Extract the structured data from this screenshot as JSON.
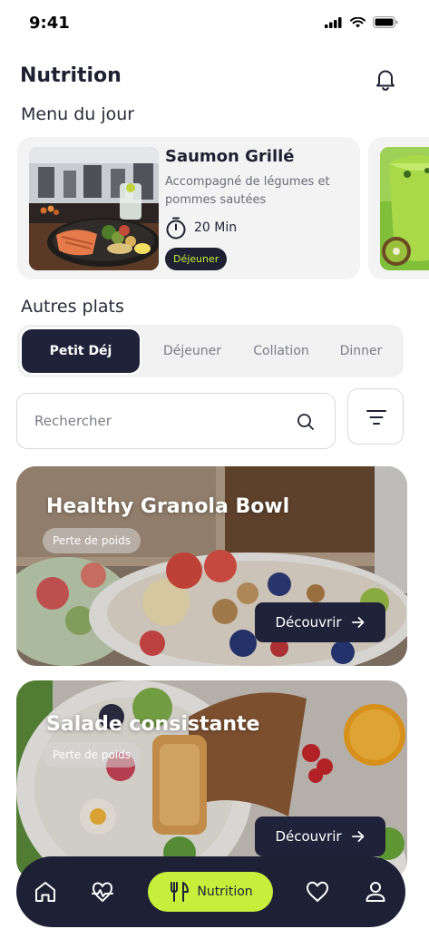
{
  "status": {
    "time": "9:41"
  },
  "header": {
    "title": "Nutrition"
  },
  "menu_du_jour": {
    "title": "Menu du jour",
    "featured": {
      "name": "Saumon Grillé",
      "description": "Accompagné de légumes et pommes sautées",
      "duration": "20 Min",
      "badge": "Déjeuner"
    }
  },
  "autres_plats": {
    "title": "Autres plats",
    "tabs": [
      {
        "label": "Petit Déj",
        "active": true
      },
      {
        "label": "Déjeuner",
        "active": false
      },
      {
        "label": "Collation",
        "active": false
      },
      {
        "label": "Dinner",
        "active": false
      }
    ]
  },
  "search": {
    "placeholder": "Rechercher",
    "value": ""
  },
  "recipes": [
    {
      "title": "Healthy Granola Bowl",
      "tag": "Perte de poids",
      "button": "Découvrir"
    },
    {
      "title": "Salade consistante",
      "tag": "Perte de poids",
      "button": "Découvrir"
    }
  ],
  "bottom_nav": {
    "items": [
      "home-icon",
      "health-icon",
      "nutrition-icon",
      "heart-icon",
      "profile-icon"
    ],
    "active_label": "Nutrition"
  },
  "colors": {
    "dark": "#1f2031",
    "accent": "#c6ef3c",
    "tab_bg": "#f1f1f2"
  }
}
